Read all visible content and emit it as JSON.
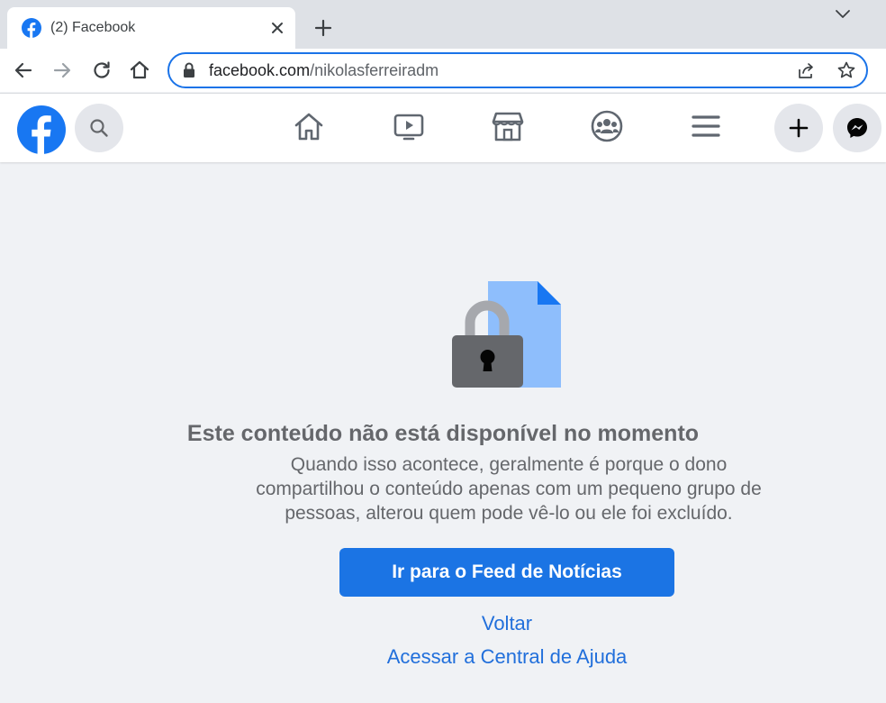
{
  "browser": {
    "tab": {
      "title": "(2) Facebook"
    },
    "address": {
      "host": "facebook.com",
      "path": "/nikolasferreiradm"
    }
  },
  "facebook": {
    "nav": [
      "home-icon",
      "watch-icon",
      "marketplace-icon",
      "groups-icon",
      "menu-icon"
    ],
    "brand_color": "#1877f2"
  },
  "content": {
    "title": "Este conteúdo não está disponível no momento",
    "description": "Quando isso acontece, geralmente é porque o dono compartilhou o conteúdo apenas com um pequeno grupo de pessoas, alterou quem pode vê-lo ou ele foi excluído.",
    "primary_button": "Ir para o Feed de Notícias",
    "back_link": "Voltar",
    "help_link": "Acessar a Central de Ajuda"
  }
}
